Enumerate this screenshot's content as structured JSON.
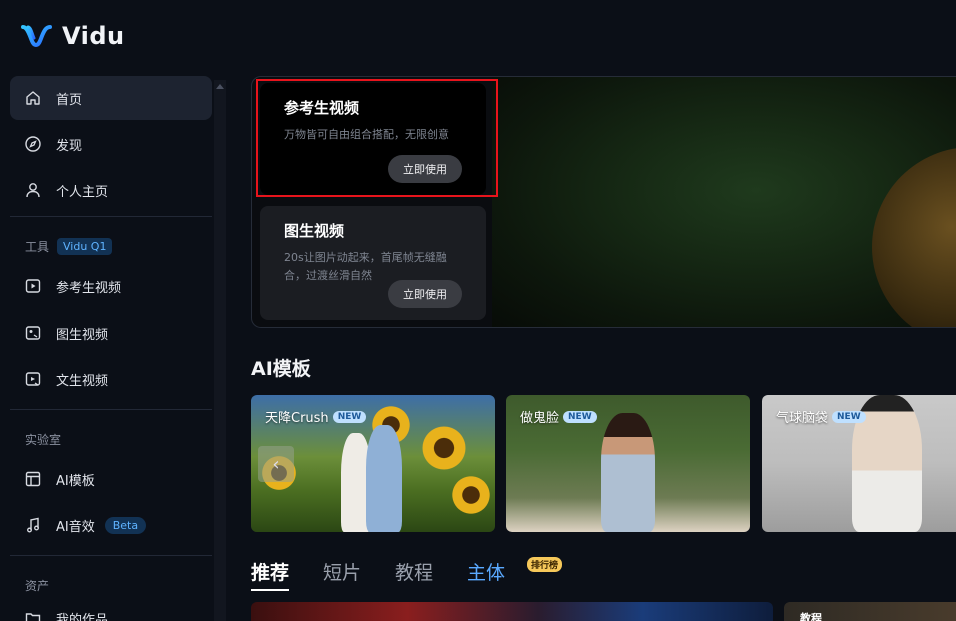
{
  "app": {
    "name": "Vidu"
  },
  "sidebar": {
    "main_items": [
      {
        "label": "首页",
        "icon": "home-icon"
      },
      {
        "label": "发现",
        "icon": "compass-icon"
      },
      {
        "label": "个人主页",
        "icon": "user-icon"
      }
    ],
    "tools_section": {
      "label": "工具",
      "badge": "Vidu Q1"
    },
    "tool_items": [
      {
        "label": "参考生视频",
        "icon": "reference-video-icon"
      },
      {
        "label": "图生视频",
        "icon": "image-video-icon"
      },
      {
        "label": "文生视频",
        "icon": "text-video-icon"
      }
    ],
    "lab_section": {
      "label": "实验室"
    },
    "lab_items": [
      {
        "label": "AI模板",
        "icon": "template-icon"
      },
      {
        "label": "AI音效",
        "icon": "music-note-icon",
        "badge": "Beta"
      }
    ],
    "assets_section": {
      "label": "资产"
    },
    "asset_items": [
      {
        "label": "我的作品",
        "icon": "folder-icon"
      }
    ]
  },
  "hero": {
    "cards": [
      {
        "title": "参考生视频",
        "desc": "万物皆可自由组合搭配，无限创意",
        "button": "立即使用"
      },
      {
        "title": "图生视频",
        "desc": "20s让图片动起来，首尾帧无缝融合，过渡丝滑自然",
        "button": "立即使用"
      }
    ]
  },
  "templates": {
    "title": "AI模板",
    "items": [
      {
        "label": "天降Crush",
        "badge": "NEW"
      },
      {
        "label": "做鬼脸",
        "badge": "NEW"
      },
      {
        "label": "气球脑袋",
        "badge": "NEW"
      }
    ]
  },
  "tabs": {
    "items": [
      "推荐",
      "短片",
      "教程",
      "主体"
    ],
    "active": "推荐",
    "rank_badge": "排行榜"
  },
  "feed": {
    "second_card_label": "教程"
  },
  "colors": {
    "accent": "#5aa9ff",
    "highlight_border": "#e8141c",
    "background": "#0b0f17"
  }
}
